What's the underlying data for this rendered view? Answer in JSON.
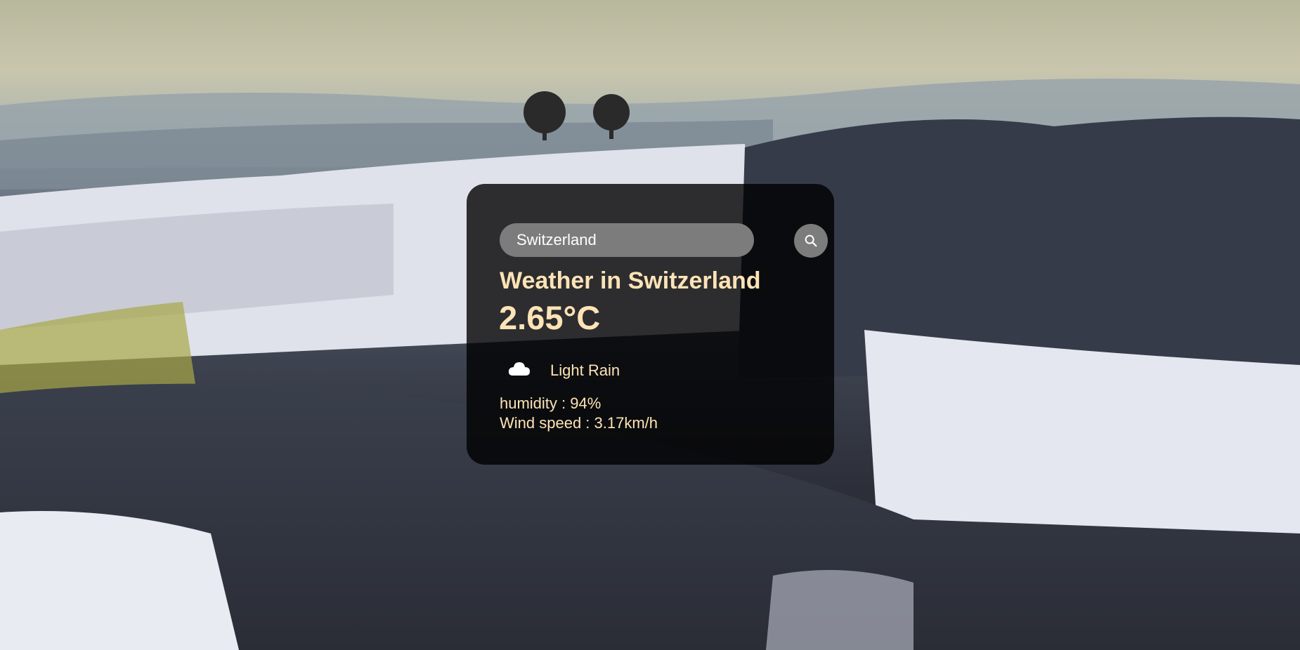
{
  "search": {
    "value": "Switzerland",
    "button_icon": "search-icon"
  },
  "weather": {
    "title": "Weather in Switzerland",
    "temperature": "2.65°C",
    "condition_icon": "cloud-icon",
    "condition": "Light Rain",
    "humidity": "humidity : 94%",
    "wind": "Wind speed : 3.17km/h"
  },
  "colors": {
    "text_accent": "#fde3b6",
    "card_background": "rgba(0,0,0,0.80)",
    "control_gray": "#7c7c7c"
  }
}
